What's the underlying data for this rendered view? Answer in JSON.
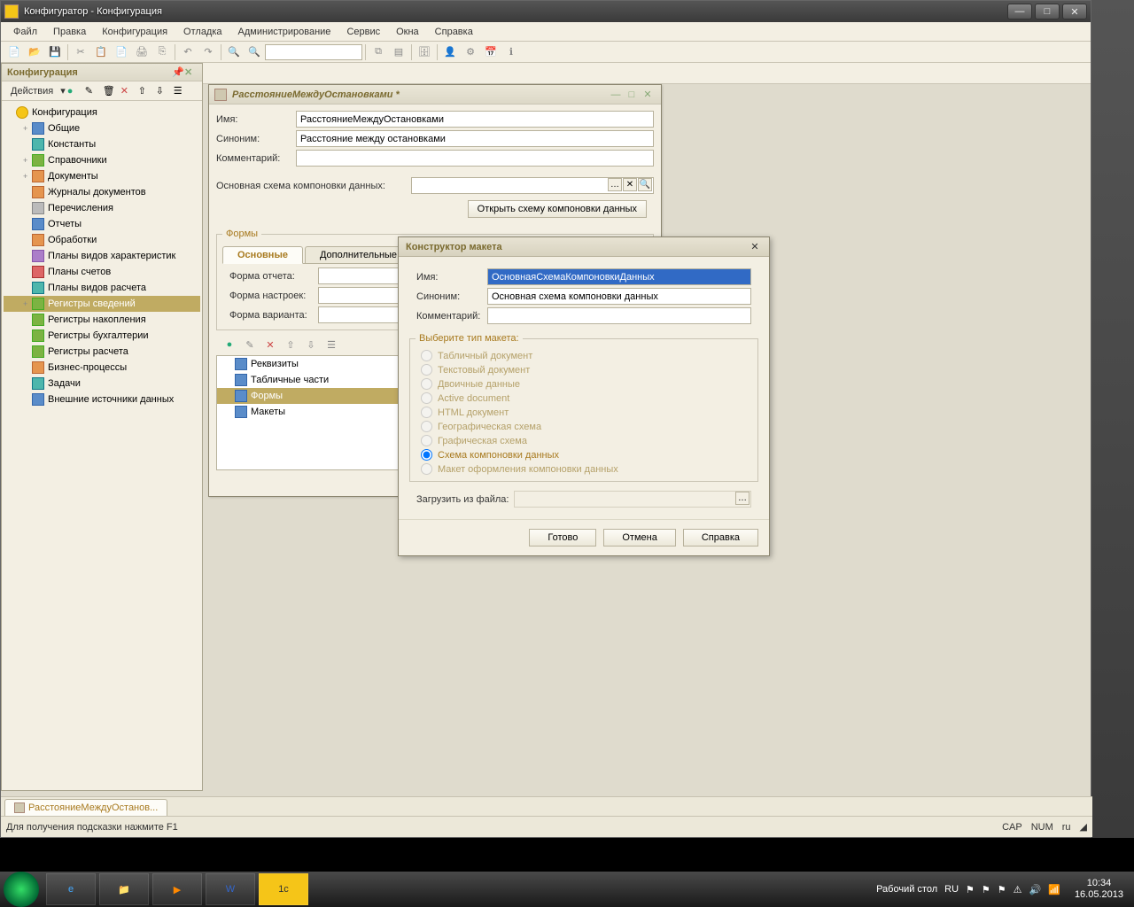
{
  "app": {
    "title": "Конфигуратор - Конфигурация"
  },
  "menu": [
    "Файл",
    "Правка",
    "Конфигурация",
    "Отладка",
    "Администрирование",
    "Сервис",
    "Окна",
    "Справка"
  ],
  "panel": {
    "title": "Конфигурация",
    "actions": "Действия",
    "tree": [
      {
        "t": "Конфигурация",
        "ic": "ic-yellow",
        "lvl": 0,
        "exp": ""
      },
      {
        "t": "Общие",
        "ic": "ic-blue",
        "lvl": 1,
        "exp": "+"
      },
      {
        "t": "Константы",
        "ic": "ic-teal",
        "lvl": 1,
        "exp": ""
      },
      {
        "t": "Справочники",
        "ic": "ic-green",
        "lvl": 1,
        "exp": "+"
      },
      {
        "t": "Документы",
        "ic": "ic-orange",
        "lvl": 1,
        "exp": "+"
      },
      {
        "t": "Журналы документов",
        "ic": "ic-orange",
        "lvl": 1,
        "exp": ""
      },
      {
        "t": "Перечисления",
        "ic": "ic-gray",
        "lvl": 1,
        "exp": ""
      },
      {
        "t": "Отчеты",
        "ic": "ic-blue",
        "lvl": 1,
        "exp": ""
      },
      {
        "t": "Обработки",
        "ic": "ic-orange",
        "lvl": 1,
        "exp": ""
      },
      {
        "t": "Планы видов характеристик",
        "ic": "ic-purple",
        "lvl": 1,
        "exp": ""
      },
      {
        "t": "Планы счетов",
        "ic": "ic-red",
        "lvl": 1,
        "exp": ""
      },
      {
        "t": "Планы видов расчета",
        "ic": "ic-teal",
        "lvl": 1,
        "exp": ""
      },
      {
        "t": "Регистры сведений",
        "ic": "ic-green",
        "lvl": 1,
        "exp": "+",
        "sel": true
      },
      {
        "t": "Регистры накопления",
        "ic": "ic-green",
        "lvl": 1,
        "exp": ""
      },
      {
        "t": "Регистры бухгалтерии",
        "ic": "ic-green",
        "lvl": 1,
        "exp": ""
      },
      {
        "t": "Регистры расчета",
        "ic": "ic-green",
        "lvl": 1,
        "exp": ""
      },
      {
        "t": "Бизнес-процессы",
        "ic": "ic-orange",
        "lvl": 1,
        "exp": ""
      },
      {
        "t": "Задачи",
        "ic": "ic-teal",
        "lvl": 1,
        "exp": ""
      },
      {
        "t": "Внешние источники данных",
        "ic": "ic-blue",
        "lvl": 1,
        "exp": ""
      }
    ]
  },
  "doc": {
    "title": "РасстояниеМеждуОстановками *",
    "name_label": "Имя:",
    "name_value": "РасстояниеМеждуОстановками",
    "synonym_label": "Синоним:",
    "synonym_value": "Расстояние между остановками",
    "comment_label": "Комментарий:",
    "schema_label": "Основная схема компоновки данных:",
    "open_button": "Открыть схему компоновки данных",
    "forms_legend": "Формы",
    "tab1": "Основные",
    "tab2": "Дополнительные",
    "form_report": "Форма отчета:",
    "form_settings": "Форма настроек:",
    "form_variant": "Форма варианта:",
    "obj": [
      "Реквизиты",
      "Табличные части",
      "Формы",
      "Макеты"
    ],
    "obj_selected": 2
  },
  "dlg": {
    "title": "Конструктор макета",
    "name_label": "Имя:",
    "name_value": "ОсновнаяСхемаКомпоновкиДанных",
    "synonym_label": "Синоним:",
    "synonym_value": "Основная схема компоновки данных",
    "comment_label": "Комментарий:",
    "type_legend": "Выберите тип макета:",
    "types": [
      "Табличный документ",
      "Текстовый документ",
      "Двоичные данные",
      "Active document",
      "HTML документ",
      "Географическая схема",
      "Графическая схема",
      "Схема компоновки данных",
      "Макет оформления компоновки данных"
    ],
    "type_selected": 7,
    "load_label": "Загрузить из файла:",
    "btn_ok": "Готово",
    "btn_cancel": "Отмена",
    "btn_help": "Справка"
  },
  "wintab": "РасстояниеМеждуОстанов...",
  "status": {
    "msg": "Для получения подсказки нажмите F1",
    "cap": "CAP",
    "num": "NUM",
    "lang": "ru"
  },
  "taskbar": {
    "desktop": "Рабочий стол",
    "input": "RU",
    "time": "10:34",
    "date": "16.05.2013"
  }
}
